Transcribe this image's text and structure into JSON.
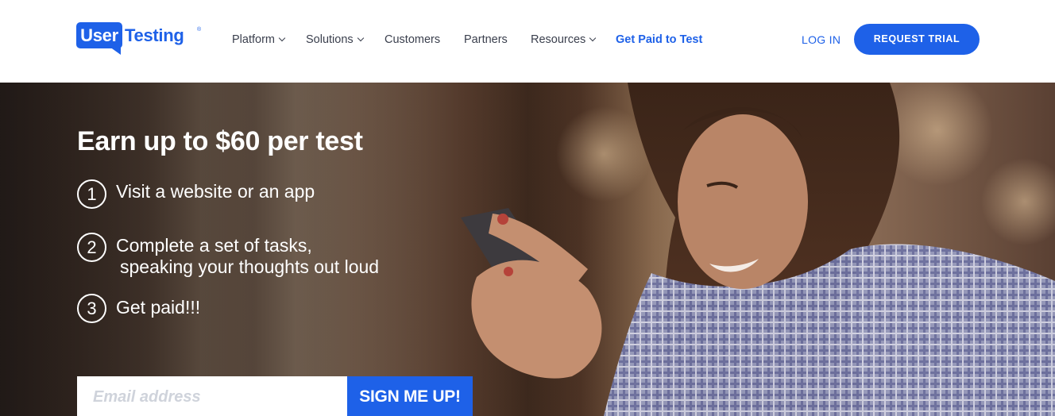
{
  "header": {
    "logo": {
      "user": "User",
      "testing": "Testing",
      "reg": "®"
    },
    "nav": [
      {
        "label": "Platform",
        "dropdown": true
      },
      {
        "label": "Solutions",
        "dropdown": true
      },
      {
        "label": "Customers",
        "dropdown": false
      },
      {
        "label": "Partners",
        "dropdown": false
      },
      {
        "label": "Resources",
        "dropdown": true
      },
      {
        "label": "Get Paid to Test",
        "dropdown": false,
        "highlight": true
      }
    ],
    "login_label": "LOG IN",
    "trial_label": "REQUEST TRIAL"
  },
  "hero": {
    "title": "Earn up to $60 per test",
    "steps": [
      {
        "num": "1",
        "line1": "Visit a website or an app",
        "line2": ""
      },
      {
        "num": "2",
        "line1": "Complete a set of tasks,",
        "line2": "speaking your thoughts out loud"
      },
      {
        "num": "3",
        "line1": "Get paid!!!",
        "line2": ""
      }
    ],
    "email_placeholder": "Email address",
    "signup_label": "SIGN ME UP!"
  },
  "colors": {
    "brand_blue": "#1e61e8",
    "nav_text": "#3a3f4d",
    "white": "#ffffff"
  }
}
